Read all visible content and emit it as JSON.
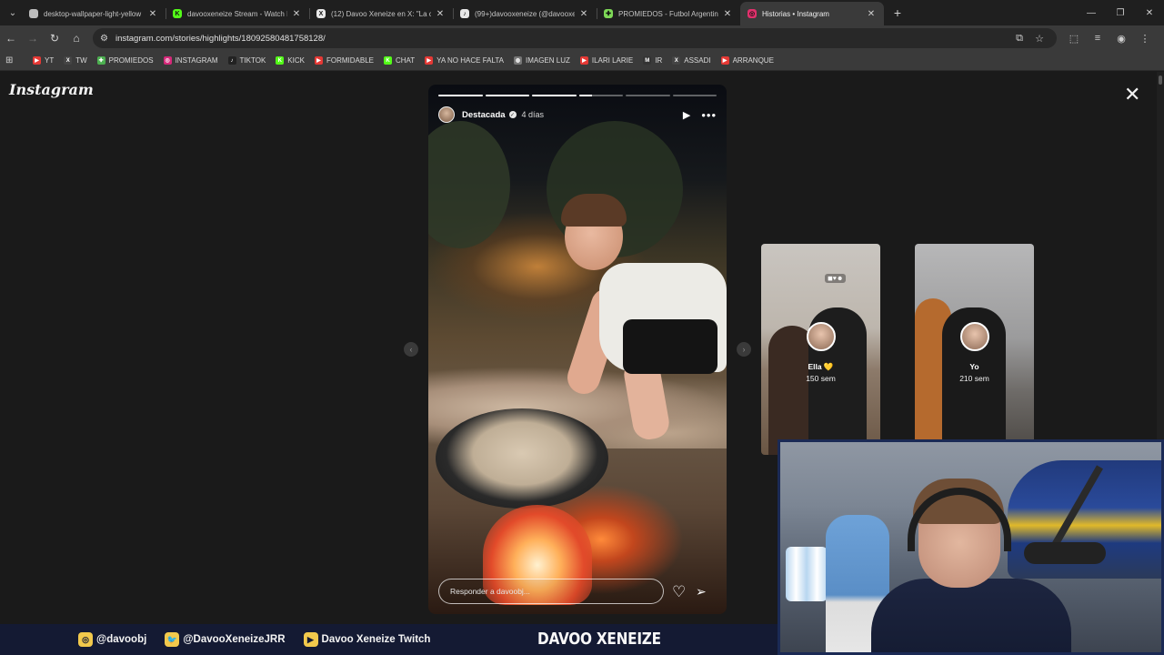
{
  "browser": {
    "tabs": [
      {
        "title": "desktop-wallpaper-light-yellow",
        "icon": "globe-icon",
        "color": "#bdbdbd",
        "glyph": ""
      },
      {
        "title": "davooxeneize Stream - Watch L",
        "icon": "kick-icon",
        "color": "#53fc18",
        "glyph": "K"
      },
      {
        "title": "(12) Davoo Xeneize en X: \"La c",
        "icon": "x-icon",
        "color": "#e8e8e8",
        "glyph": "X"
      },
      {
        "title": "(99+)davooxeneize (@davooxe",
        "icon": "tiktok-icon",
        "color": "#e8e8e8",
        "glyph": "♪"
      },
      {
        "title": "PROMIEDOS - Futbol Argentino",
        "icon": "promiedos-icon",
        "color": "#7ed957",
        "glyph": "✚"
      },
      {
        "title": "Historias • Instagram",
        "icon": "instagram-icon",
        "color": "#e1306c",
        "glyph": "◎"
      }
    ],
    "url": "instagram.com/stories/highlights/18092580481758128/",
    "bookmarks": [
      {
        "label": "YT",
        "icon": "youtube-icon",
        "color": "#e53935",
        "glyph": "▶"
      },
      {
        "label": "TW",
        "icon": "x-icon",
        "color": "#444",
        "glyph": "X"
      },
      {
        "label": "PROMIEDOS",
        "icon": "promiedos-icon",
        "color": "#4caf50",
        "glyph": "✚"
      },
      {
        "label": "INSTAGRAM",
        "icon": "instagram-icon",
        "color": "#d6287a",
        "glyph": "◎"
      },
      {
        "label": "TIKTOK",
        "icon": "tiktok-icon",
        "color": "#222",
        "glyph": "♪"
      },
      {
        "label": "KICK",
        "icon": "kick-icon",
        "color": "#53fc18",
        "glyph": "K"
      },
      {
        "label": "FORMIDABLE",
        "icon": "youtube-icon",
        "color": "#e53935",
        "glyph": "▶"
      },
      {
        "label": "CHAT",
        "icon": "kick-icon",
        "color": "#53fc18",
        "glyph": "K"
      },
      {
        "label": "YA NO HACE FALTA",
        "icon": "youtube-icon",
        "color": "#e53935",
        "glyph": "▶"
      },
      {
        "label": "IMAGEN LUZ",
        "icon": "globe-icon",
        "color": "#777",
        "glyph": "◍"
      },
      {
        "label": "ILARI LARIE",
        "icon": "youtube-icon",
        "color": "#e53935",
        "glyph": "▶"
      },
      {
        "label": "IR",
        "icon": "mk-icon",
        "color": "#333",
        "glyph": "M"
      },
      {
        "label": "ASSADI",
        "icon": "x-icon",
        "color": "#444",
        "glyph": "X"
      },
      {
        "label": "ARRANQUE",
        "icon": "youtube-icon",
        "color": "#e53935",
        "glyph": "▶"
      }
    ]
  },
  "instagram": {
    "logo": "Instagram",
    "story": {
      "user": "Destacada",
      "time": "4 días",
      "progress": [
        1,
        1,
        1,
        0.3,
        0,
        0
      ],
      "reply_placeholder": "Responder a davoobj..."
    },
    "previews": [
      {
        "name": "Ella 💛",
        "time": "150 sem"
      },
      {
        "name": "Yo",
        "time": "210 sem"
      }
    ]
  },
  "stream": {
    "socials": [
      {
        "label": "@davoobj",
        "icon": "instagram-icon",
        "color": "#f2c94c",
        "glyph": "◎"
      },
      {
        "label": "@DavooXeneizeJRR",
        "icon": "twitter-bird-icon",
        "color": "#f2c94c",
        "glyph": "🐦"
      },
      {
        "label": "Davoo Xeneize Twitch",
        "icon": "youtube-icon",
        "color": "#f2c94c",
        "glyph": "▶"
      }
    ],
    "brand": "DAVOO XENEIZE"
  }
}
